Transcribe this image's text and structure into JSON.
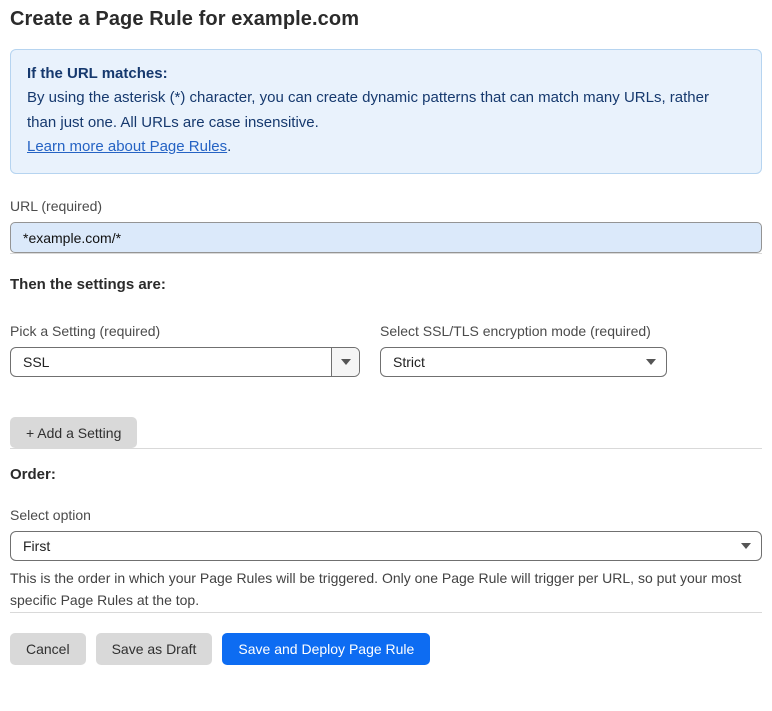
{
  "page": {
    "title": "Create a Page Rule for example.com"
  },
  "info_box": {
    "heading": "If the URL matches:",
    "body": "By using the asterisk (*) character, you can create dynamic patterns that can match many URLs, rather than just one. All URLs are case insensitive.",
    "link": "Learn more about Page Rules",
    "link_suffix": "."
  },
  "url_field": {
    "label": "URL (required)",
    "value": "*example.com/*"
  },
  "settings_section": {
    "heading": "Then the settings are:",
    "setting_select": {
      "label": "Pick a Setting (required)",
      "value": "SSL"
    },
    "mode_select": {
      "label": "Select SSL/TLS encryption mode (required)",
      "value": "Strict"
    },
    "add_setting_label": "+ Add a Setting"
  },
  "order_section": {
    "heading": "Order:",
    "select_label": "Select option",
    "select_value": "First",
    "help_text": "This is the order in which your Page Rules will be triggered. Only one Page Rule will trigger per URL, so put your most specific Page Rules at the top."
  },
  "footer": {
    "cancel_label": "Cancel",
    "save_draft_label": "Save as Draft",
    "save_deploy_label": "Save and Deploy Page Rule"
  },
  "colors": {
    "accent_blue": "#0d6cf2",
    "info_background": "#e9f2fc",
    "info_border": "#b6d4f0",
    "info_text": "#16396e",
    "link_blue": "#2563c4",
    "url_input_background": "#dbe9fa",
    "button_gray": "#d9d9d9"
  }
}
